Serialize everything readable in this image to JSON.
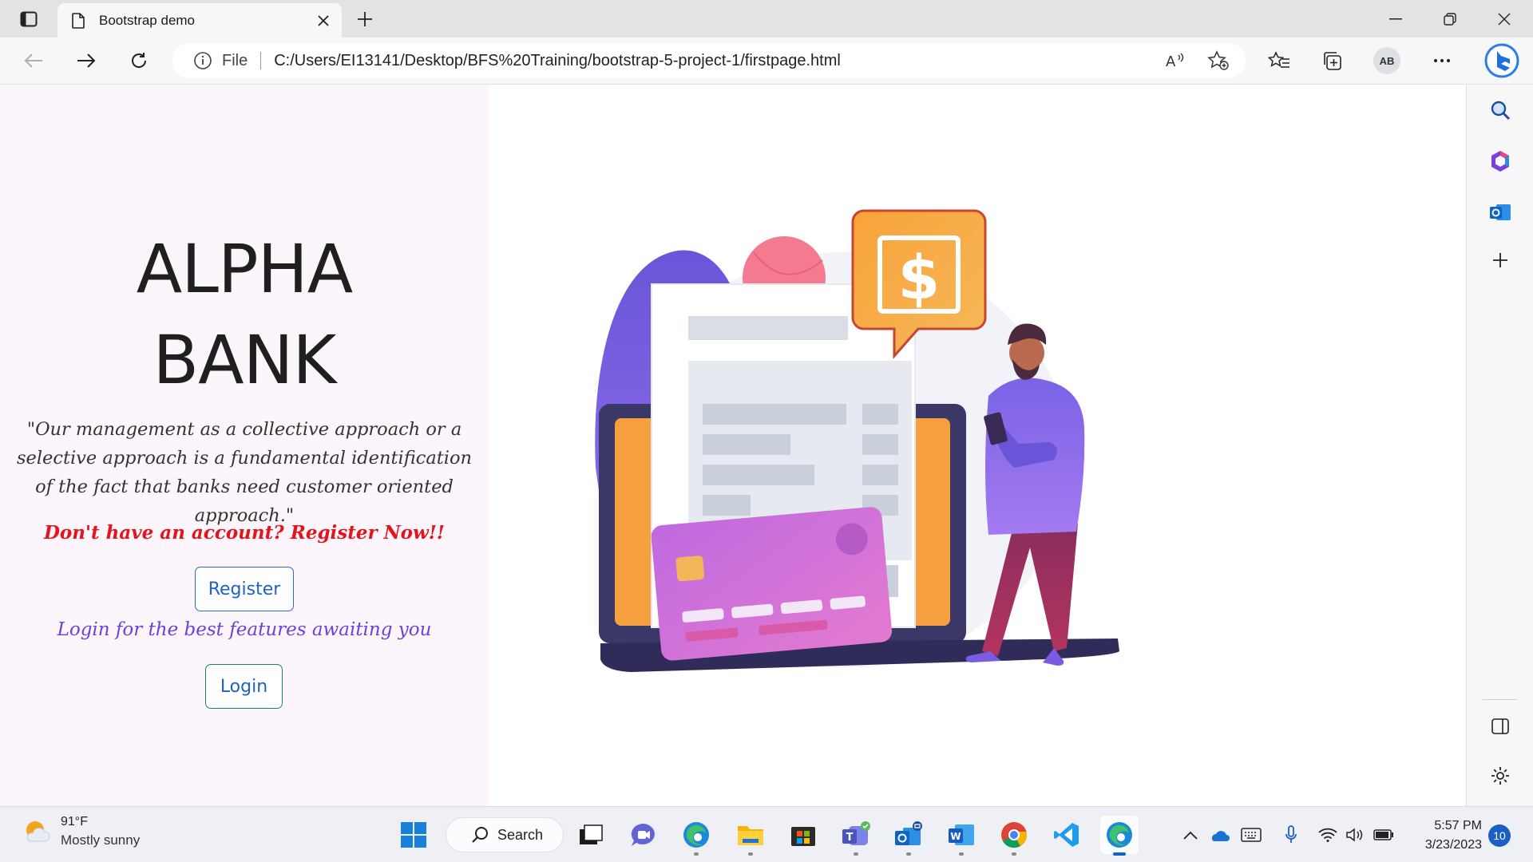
{
  "browser": {
    "tab_title": "Bootstrap demo",
    "scheme_label": "File",
    "url": "C:/Users/EI13141/Desktop/BFS%20Training/bootstrap-5-project-1/firstpage.html",
    "profile_initials": "AB"
  },
  "page": {
    "title_line1": "ALPHA",
    "title_line2": "BANK",
    "quote": "\"Our management as a collective approach or a selective approach is a fundamental identification of the fact that banks need customer oriented approach.\"",
    "register_prompt": "Don't have an account? Register Now!!",
    "register_button": "Register",
    "login_prompt": "Login for the best features awaiting you",
    "login_button": "Login",
    "colors": {
      "left_panel_bg": "#fdf5fc",
      "register_prompt": "#e5141b",
      "login_prompt": "#6842d9",
      "button_text": "#1e62c8"
    }
  },
  "taskbar": {
    "weather_temp": "91°F",
    "weather_condition": "Mostly sunny",
    "search_label": "Search",
    "time": "5:57 PM",
    "date": "3/23/2023",
    "notification_count": "10",
    "apps": [
      "start-menu",
      "search",
      "task-view",
      "teams-chat",
      "edge",
      "file-explorer",
      "microsoft-store",
      "teams",
      "outlook",
      "word",
      "chrome",
      "vscode",
      "edge-active"
    ]
  }
}
